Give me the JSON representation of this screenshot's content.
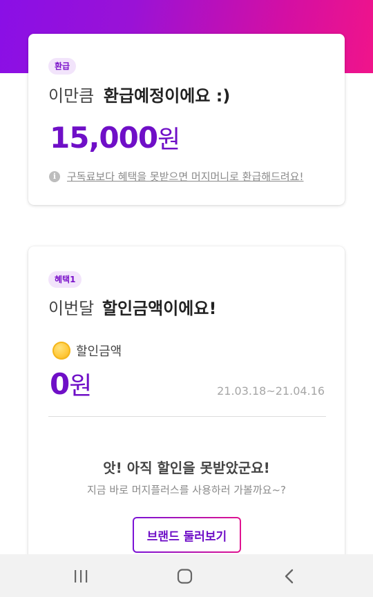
{
  "refund_card": {
    "badge": "환급",
    "headline_light": "이만큼",
    "headline_bold": "환급예정이에요 :)",
    "amount_value": "15,000",
    "amount_unit": "원",
    "note": "구독료보다 혜택을 못받으면 머지머니로 환급해드려요!"
  },
  "benefit_card": {
    "badge": "혜택1",
    "headline_light": "이번달",
    "headline_bold": "할인금액이에요!",
    "coin_label": "할인금액",
    "amount_value": "0",
    "amount_unit": "원",
    "period": "21.03.18~21.04.16",
    "empty_title": "앗! 아직 할인을 못받았군요!",
    "empty_subtitle": "지금 바로 머지플러스를 사용하러 가볼까요~?",
    "button_label": "브랜드 둘러보기"
  },
  "colors": {
    "accent_purple": "#6f0fc7",
    "gradient_start": "#8a0fe6",
    "gradient_end": "#f0148a"
  },
  "nav_icons": [
    "recent-apps-icon",
    "home-icon",
    "back-icon"
  ]
}
